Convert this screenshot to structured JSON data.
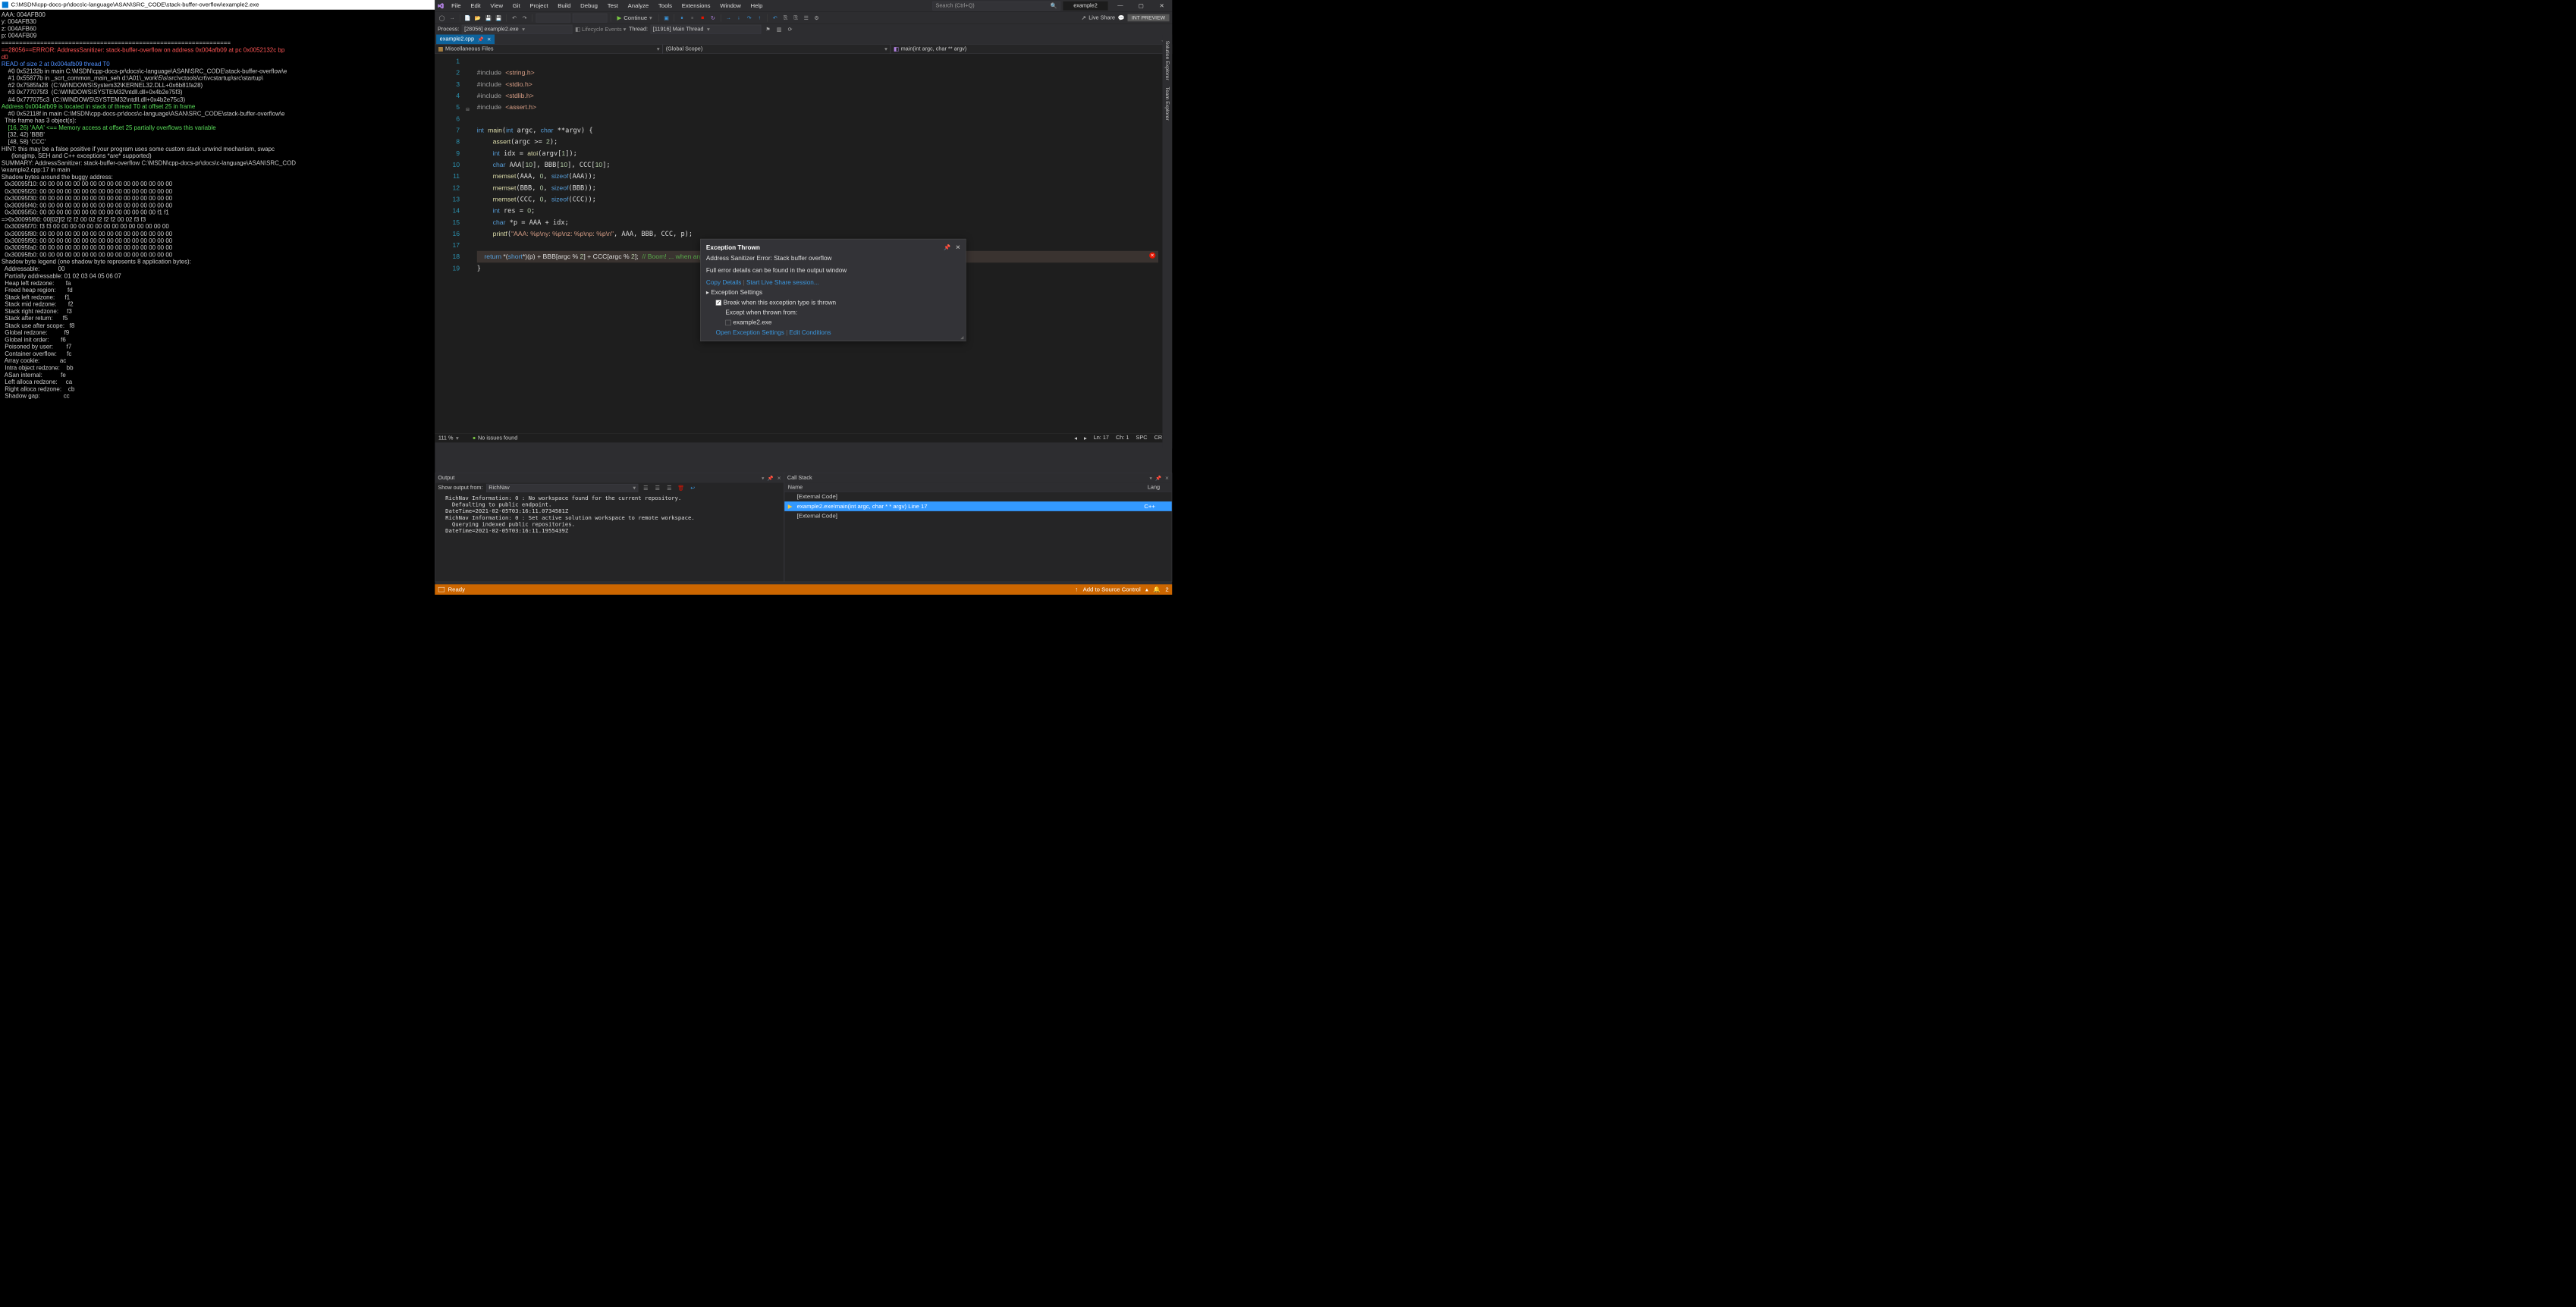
{
  "console": {
    "title": "C:\\MSDN\\cpp-docs-pr\\docs\\c-language\\ASAN\\SRC_CODE\\stack-buffer-overflow\\example2.exe",
    "lines": [
      {
        "t": "AAA: 004AFB00"
      },
      {
        "t": "y: 004AFB30"
      },
      {
        "t": "z: 004AFB60"
      },
      {
        "t": "p: 004AFB09"
      },
      {
        "t": "================================================================="
      },
      {
        "c": "c-red",
        "t": "==28056==ERROR: AddressSanitizer: stack-buffer-overflow on address 0x004afb09 at pc 0x0052132c bp"
      },
      {
        "c": "c-red",
        "t": "d0"
      },
      {
        "c": "c-blue",
        "t": "READ of size 2 at 0x004afb09 thread T0"
      },
      {
        "t": "    #0 0x52132b in main C:\\MSDN\\cpp-docs-pr\\docs\\c-language\\ASAN\\SRC_CODE\\stack-buffer-overflow\\e"
      },
      {
        "t": "    #1 0x55877b in _scrt_common_main_seh d:\\A01\\_work\\5\\s\\src\\vctools\\crt\\vcstartup\\src\\startup\\"
      },
      {
        "t": "    #2 0x7585fa28  (C:\\WINDOWS\\System32\\KERNEL32.DLL+0x6b81fa28)"
      },
      {
        "t": "    #3 0x777075f3  (C:\\WINDOWS\\SYSTEM32\\ntdll.dll+0x4b2e75f3)"
      },
      {
        "t": "    #4 0x777075c3  (C:\\WINDOWS\\SYSTEM32\\ntdll.dll+0x4b2e75c3)"
      },
      {
        "t": ""
      },
      {
        "c": "c-green",
        "t": "Address 0x004afb09 is located in stack of thread T0 at offset 25 in frame"
      },
      {
        "t": "    #0 0x52118f in main C:\\MSDN\\cpp-docs-pr\\docs\\c-language\\ASAN\\SRC_CODE\\stack-buffer-overflow\\e"
      },
      {
        "t": ""
      },
      {
        "t": "  This frame has 3 object(s):"
      },
      {
        "c": "c-green",
        "t": "    [16, 26) 'AAA' <== Memory access at offset 25 partially overflows this variable"
      },
      {
        "t": "    [32, 42) 'BBB'"
      },
      {
        "t": "    [48, 58) 'CCC'"
      },
      {
        "t": "HINT: this may be a false positive if your program uses some custom stack unwind mechanism, swapc"
      },
      {
        "t": "      (longjmp, SEH and C++ exceptions *are* supported)"
      },
      {
        "t": "SUMMARY: AddressSanitizer: stack-buffer-overflow C:\\MSDN\\cpp-docs-pr\\docs\\c-language\\ASAN\\SRC_COD"
      },
      {
        "t": "\\example2.cpp:17 in main"
      },
      {
        "t": "Shadow bytes around the buggy address:"
      },
      {
        "t": "  0x30095f10: 00 00 00 00 00 00 00 00 00 00 00 00 00 00 00 00"
      },
      {
        "t": "  0x30095f20: 00 00 00 00 00 00 00 00 00 00 00 00 00 00 00 00"
      },
      {
        "t": "  0x30095f30: 00 00 00 00 00 00 00 00 00 00 00 00 00 00 00 00"
      },
      {
        "t": "  0x30095f40: 00 00 00 00 00 00 00 00 00 00 00 00 00 00 00 00"
      },
      {
        "t": "  0x30095f50: 00 00 00 00 00 00 00 00 00 00 00 00 00 00 f1 f1"
      },
      {
        "t": "=>0x30095f60: 00[02]f2 f2 f2 00 02 f2 f2 f2 00 02 f3 f3"
      },
      {
        "t": "  0x30095f70: f3 f3 00 00 00 00 00 00 00 00 00 00 00 00 00 00"
      },
      {
        "t": "  0x30095f80: 00 00 00 00 00 00 00 00 00 00 00 00 00 00 00 00"
      },
      {
        "t": "  0x30095f90: 00 00 00 00 00 00 00 00 00 00 00 00 00 00 00 00"
      },
      {
        "t": "  0x30095fa0: 00 00 00 00 00 00 00 00 00 00 00 00 00 00 00 00"
      },
      {
        "t": "  0x30095fb0: 00 00 00 00 00 00 00 00 00 00 00 00 00 00 00 00"
      },
      {
        "t": "Shadow byte legend (one shadow byte represents 8 application bytes):"
      },
      {
        "t": "  Addressable:           00"
      },
      {
        "t": "  Partially addressable: 01 02 03 04 05 06 07"
      },
      {
        "t": "  Heap left redzone:       fa"
      },
      {
        "t": "  Freed heap region:       fd"
      },
      {
        "t": "  Stack left redzone:      f1"
      },
      {
        "t": "  Stack mid redzone:       f2"
      },
      {
        "t": "  Stack right redzone:     f3"
      },
      {
        "t": "  Stack after return:      f5"
      },
      {
        "t": "  Stack use after scope:   f8"
      },
      {
        "t": "  Global redzone:          f9"
      },
      {
        "t": "  Global init order:       f6"
      },
      {
        "t": "  Poisoned by user:        f7"
      },
      {
        "t": "  Container overflow:      fc"
      },
      {
        "t": "  Array cookie:            ac"
      },
      {
        "t": "  Intra object redzone:    bb"
      },
      {
        "t": "  ASan internal:           fe"
      },
      {
        "t": "  Left alloca redzone:     ca"
      },
      {
        "t": "  Right alloca redzone:    cb"
      },
      {
        "t": "  Shadow gap:              cc"
      }
    ]
  },
  "menu": [
    "File",
    "Edit",
    "View",
    "Git",
    "Project",
    "Build",
    "Debug",
    "Test",
    "Analyze",
    "Tools",
    "Extensions",
    "Window",
    "Help"
  ],
  "search_placeholder": "Search (Ctrl+Q)",
  "solution_name": "example2",
  "continue_label": "Continue",
  "live_share_label": "Live Share",
  "int_preview": "INT PREVIEW",
  "dbg": {
    "process_label": "Process:",
    "process_value": "[28056] example2.exe",
    "lifecycle": "Lifecycle Events",
    "thread_label": "Thread:",
    "thread_value": "[11916] Main Thread"
  },
  "tab_name": "example2.cpp",
  "nav": {
    "scope1": "Miscellaneous Files",
    "scope2": "(Global Scope)",
    "scope3": "main(int argc, char ** argv)"
  },
  "code_lines": [
    "1",
    "2",
    "3",
    "4",
    "5",
    "6",
    "7",
    "8",
    "9",
    "10",
    "11",
    "12",
    "13",
    "14",
    "15",
    "16",
    "17",
    "18",
    "19"
  ],
  "exception": {
    "title": "Exception Thrown",
    "msg1": "Address Sanitizer Error: Stack buffer overflow",
    "msg2": "Full error details can be found in the output window",
    "copy": "Copy Details",
    "live": "Start Live Share session...",
    "settings": "Exception Settings",
    "break": "Break when this exception type is thrown",
    "except": "Except when thrown from:",
    "module": "example2.exe",
    "open": "Open Exception Settings",
    "edit": "Edit Conditions"
  },
  "editor_status": {
    "zoom": "111 %",
    "issues": "No issues found",
    "ln": "Ln: 17",
    "ch": "Ch: 1",
    "spc": "SPC",
    "crlf": "CRLF"
  },
  "output": {
    "title": "Output",
    "show_from": "Show output from:",
    "source": "RichNav",
    "body": "  RichNav Information: 0 : No workspace found for the current repository.\n    Defaulting to public endpoint.\n  DateTime=2021-02-05T03:16:11.0734581Z\n  RichNav Information: 0 : Set active solution workspace to remote workspace.\n    Querying indexed public repositories.\n  DateTime=2021-02-05T03:16:11.1955439Z"
  },
  "callstack": {
    "title": "Call Stack",
    "col_name": "Name",
    "col_lang": "Lang",
    "rows": [
      {
        "name": "[External Code]",
        "lang": ""
      },
      {
        "name": "example2.exe!main(int argc, char * * argv) Line 17",
        "lang": "C++",
        "sel": true
      },
      {
        "name": "[External Code]",
        "lang": ""
      }
    ]
  },
  "status": {
    "ready": "Ready",
    "add_src": "Add to Source Control",
    "two": "2"
  },
  "sidebars": [
    "Solution Explorer",
    "Team Explorer"
  ]
}
